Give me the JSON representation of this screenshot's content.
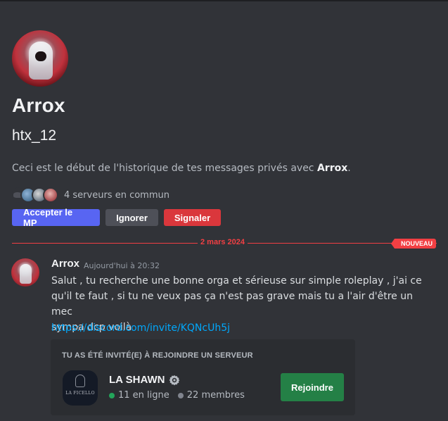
{
  "profile": {
    "display_name": "Arrox",
    "username": "htx_12",
    "intro_prefix": "Ceci est le début de l'historique de tes messages privés avec ",
    "intro_name": "Arrox",
    "intro_suffix": ".",
    "mutual_servers": "4 serveurs en commun"
  },
  "actions": {
    "accept_label": "Accepter le MP",
    "ignore_label": "Ignorer",
    "report_label": "Signaler"
  },
  "divider": {
    "date": "2 mars 2024",
    "badge": "NOUVEAU"
  },
  "message": {
    "author": "Arrox",
    "timestamp": "Aujourd'hui à 20:32",
    "line1": "Salut , tu recherche une bonne orga et sérieuse sur simple roleplay , j'ai ce",
    "line2": "qu'il te faut , si tu ne veux pas ça n'est pas grave mais tu a l'air d'être un mec",
    "line3": "sympa dcp voilà",
    "link": "https://discord.com/invite/KQNcUh5j"
  },
  "invite": {
    "title": "TU AS ÉTÉ INVITÉ(E) À REJOINDRE UN SERVEUR",
    "guild_name": "LA SHAWN",
    "guild_icon_text": "LA FICELLO",
    "online": "11 en ligne",
    "members": "22 membres",
    "join_label": "Rejoindre"
  },
  "colors": {
    "background": "#313338",
    "accent": "#5865f2",
    "danger": "#da373c",
    "new_divider": "#f23f43",
    "link": "#00a8fc",
    "join": "#248046",
    "online": "#23a55a"
  },
  "icons": {
    "partner": "partner-badge-icon",
    "servers": [
      "server-icon-1",
      "server-icon-2",
      "server-icon-3",
      "server-icon-4"
    ]
  }
}
